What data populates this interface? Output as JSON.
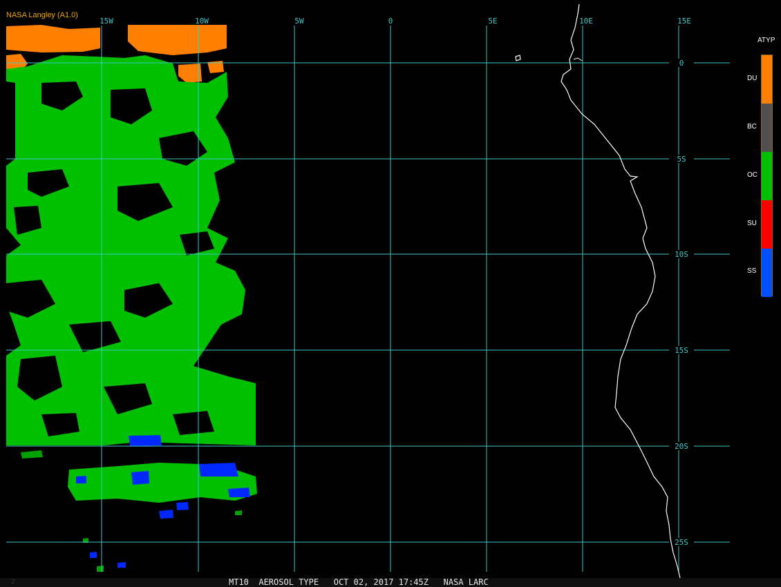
{
  "credit": "NASA Langley (A1.0)",
  "grid": {
    "lon_labels": [
      "15W",
      "10W",
      "5W",
      "0",
      "5E",
      "10E",
      "15E"
    ],
    "lat_labels": [
      "0",
      "5S",
      "10S",
      "15S",
      "20S",
      "25S"
    ],
    "line_color": "#40c8c8"
  },
  "legend": {
    "title": "ATYP",
    "items": [
      {
        "code": "DU",
        "color": "#ff8000"
      },
      {
        "code": "BC",
        "color": "#505050"
      },
      {
        "code": "OC",
        "color": "#00c000"
      },
      {
        "code": "SU",
        "color": "#ff0000"
      },
      {
        "code": "SS",
        "color": "#0050ff"
      }
    ]
  },
  "status": {
    "frame": "2",
    "text": "MT10  AEROSOL TYPE   OCT 02, 2017 17:45Z   NASA LARC"
  }
}
